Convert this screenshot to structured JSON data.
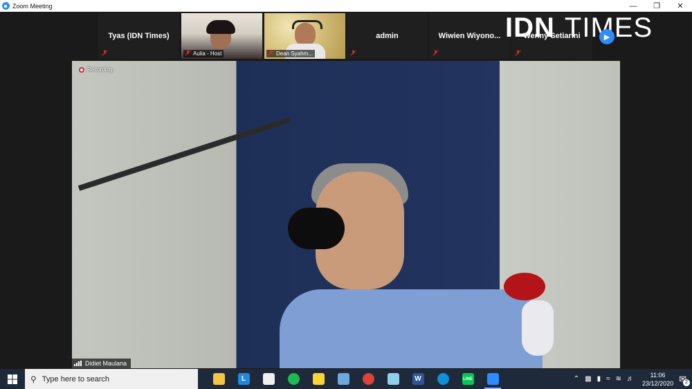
{
  "window": {
    "title": "Zoom Meeting",
    "controls": [
      "—",
      "❐",
      "✕"
    ]
  },
  "participants": [
    {
      "name": "Tyas (IDN Times)",
      "muted": true,
      "video": false
    },
    {
      "name": "Aulia - Host",
      "muted": true,
      "video": true
    },
    {
      "name": "Dean Syahm...",
      "muted": true,
      "video": true
    },
    {
      "name": "admin",
      "muted": true,
      "video": false
    },
    {
      "name": "Wiwien  Wiyono...",
      "muted": true,
      "video": false
    },
    {
      "name": "Wenny Setiarini",
      "muted": true,
      "video": false
    }
  ],
  "watermark": {
    "part1": "IDN",
    "part2": "TIMES"
  },
  "main_video": {
    "recording_label": "Recording",
    "speaker_name": "Didiet Maulana"
  },
  "taskbar": {
    "search_placeholder": "Type here to search",
    "apps": [
      {
        "name": "file-explorer",
        "glyph": "",
        "color": "#f4c542"
      },
      {
        "name": "l-app",
        "glyph": "L",
        "color": "#1e88e5"
      },
      {
        "name": "store",
        "glyph": "",
        "color": "#f0f0f0"
      },
      {
        "name": "spotify",
        "glyph": "",
        "color": "#1db954"
      },
      {
        "name": "sticky-notes",
        "glyph": "",
        "color": "#f7d633"
      },
      {
        "name": "paint",
        "glyph": "",
        "color": "#6fa8dc"
      },
      {
        "name": "chrome",
        "glyph": "",
        "color": "#db4437"
      },
      {
        "name": "notepad",
        "glyph": "",
        "color": "#8fd0e8"
      },
      {
        "name": "word",
        "glyph": "W",
        "color": "#2b579a"
      },
      {
        "name": "edge",
        "glyph": "",
        "color": "#0f8fd6"
      },
      {
        "name": "line",
        "glyph": "LINE",
        "color": "#06c755"
      },
      {
        "name": "zoom",
        "glyph": "",
        "color": "#2d8cff"
      }
    ],
    "time": "11:06",
    "date": "23/12/2020",
    "notifications": "2"
  },
  "colors": {
    "accent": "#2d8cff",
    "recording": "#e02828",
    "muted": "#e02828"
  }
}
